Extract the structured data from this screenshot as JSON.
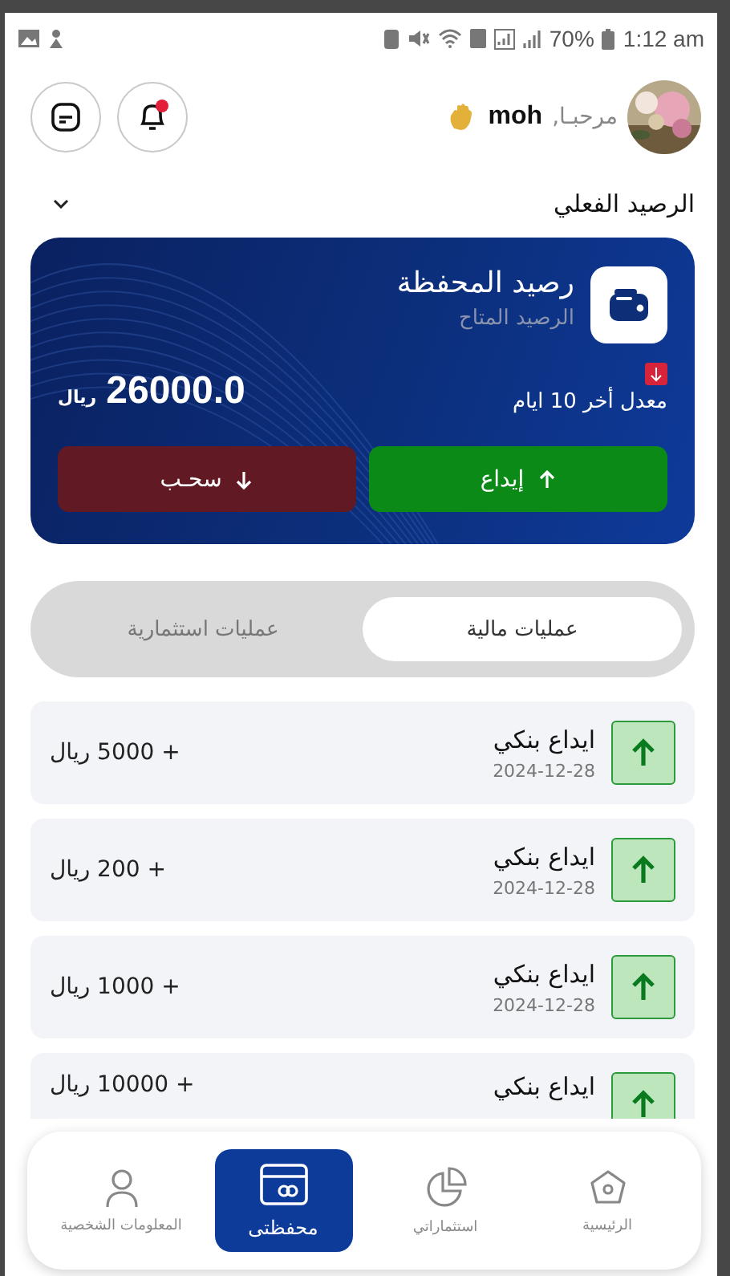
{
  "status_bar": {
    "battery": "70%",
    "time": "1:12 am"
  },
  "header": {
    "greeting": "مرحبـا,",
    "name": "moh",
    "notification_dot": true
  },
  "balance_selector": {
    "label": "الرصيد الفعلي"
  },
  "wallet_card": {
    "title": "رصيد المحفظة",
    "subtitle": "الرصيد المتاح",
    "amount": "26000.0",
    "currency": "ريال",
    "trend_falling": true,
    "period": "معدل أخر 10 ايام",
    "actions": [
      {
        "kind": "deposit",
        "label": "إيداع"
      },
      {
        "kind": "withdraw",
        "label": "سحـب"
      }
    ]
  },
  "tabs": [
    {
      "label": "عمليات مالية",
      "selected": true
    },
    {
      "label": "عمليات استثمارية",
      "selected": false
    }
  ],
  "transactions": [
    {
      "title": "ايداع بنكي",
      "date": "2024-12-28",
      "amount": "+ 5000 ريال",
      "kind": "deposit"
    },
    {
      "title": "ايداع بنكي",
      "date": "2024-12-28",
      "amount": "+ 200 ريال",
      "kind": "deposit"
    },
    {
      "title": "ايداع بنكي",
      "date": "2024-12-28",
      "amount": "+ 1000 ريال",
      "kind": "deposit"
    },
    {
      "title": "ايداع بنكي",
      "amount": "+ 10000 ريال",
      "kind": "deposit"
    }
  ],
  "bottom_nav": [
    {
      "kind": "home",
      "label": "الرئيسية",
      "selected": false
    },
    {
      "kind": "investments",
      "label": "استثماراتي",
      "selected": false
    },
    {
      "kind": "wallet",
      "label": "محفظتى",
      "selected": true
    },
    {
      "kind": "profile",
      "label": "المعلومات الشخصية",
      "selected": false
    }
  ]
}
